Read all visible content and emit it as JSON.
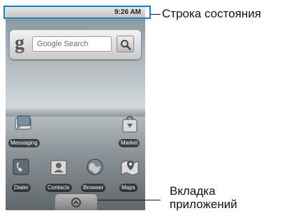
{
  "status_bar": {
    "time": "9:26 AM"
  },
  "search_widget": {
    "logo": "g",
    "placeholder": "Google Search"
  },
  "apps_top": [
    {
      "label": "Messaging",
      "icon": "messaging-icon"
    },
    {
      "label": "Market",
      "icon": "market-icon"
    }
  ],
  "apps_dock": [
    {
      "label": "Dialer",
      "icon": "dialer-icon"
    },
    {
      "label": "Contacts",
      "icon": "contacts-icon"
    },
    {
      "label": "Browser",
      "icon": "browser-icon"
    },
    {
      "label": "Maps",
      "icon": "maps-icon"
    }
  ],
  "annotations": {
    "status_bar": "Строка состояния",
    "app_tab_line1": "Вкладка",
    "app_tab_line2": "приложений"
  },
  "colors": {
    "highlight": "#0f7fd6"
  }
}
